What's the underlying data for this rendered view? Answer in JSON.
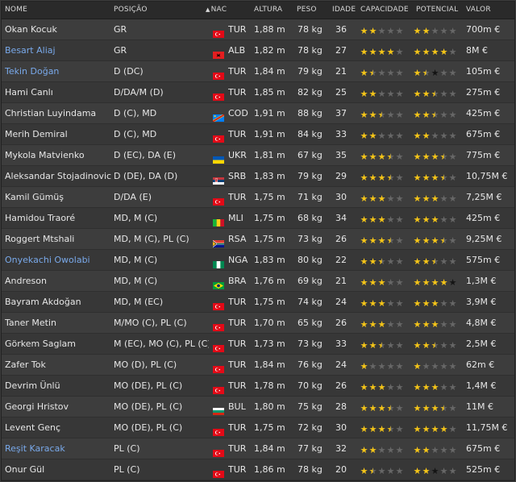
{
  "columns": {
    "name": "NOME",
    "position": "POSIÇÃO",
    "nat": "NAC",
    "height": "ALTURA",
    "weight": "PESO",
    "age": "IDADE",
    "ability": "CAPACIDADE",
    "potential": "POTENCIAL",
    "value": "VALOR"
  },
  "colors": {
    "link": "#79a9ea",
    "star_full": "#f5c518",
    "star_empty": "#676767",
    "star_dark": "#141414"
  },
  "rows": [
    {
      "name": "Okan Kocuk",
      "link": false,
      "position": "GR",
      "flag": "tr",
      "nat": "TUR",
      "height": "1,88 m",
      "weight": "78 kg",
      "age": "36",
      "ability": 2,
      "potential": 2,
      "value": "700m €"
    },
    {
      "name": "Besart Aliaj",
      "link": true,
      "position": "GR",
      "flag": "al",
      "nat": "ALB",
      "height": "1,82 m",
      "weight": "78 kg",
      "age": "27",
      "ability": 4,
      "potential": 4,
      "value": "8M €"
    },
    {
      "name": "Tekin Doğan",
      "link": true,
      "position": "D (DC)",
      "flag": "tr",
      "nat": "TUR",
      "height": "1,84 m",
      "weight": "79 kg",
      "age": "21",
      "ability": 1.5,
      "potential": 1.5,
      "potential_dark": 1,
      "value": "105m €"
    },
    {
      "name": "Hami Canlı",
      "link": false,
      "position": "D/DA/M (D)",
      "flag": "tr",
      "nat": "TUR",
      "height": "1,85 m",
      "weight": "82 kg",
      "age": "25",
      "ability": 2,
      "potential": 2.5,
      "value": "275m €"
    },
    {
      "name": "Christian Luyindama",
      "link": false,
      "position": "D (C), MD",
      "flag": "cd",
      "nat": "COD",
      "height": "1,91 m",
      "weight": "88 kg",
      "age": "37",
      "ability": 2.5,
      "potential": 2.5,
      "value": "425m €"
    },
    {
      "name": "Merih Demiral",
      "link": false,
      "position": "D (C), MD",
      "flag": "tr",
      "nat": "TUR",
      "height": "1,91 m",
      "weight": "84 kg",
      "age": "33",
      "ability": 2,
      "potential": 2,
      "value": "675m €"
    },
    {
      "name": "Mykola Matvienko",
      "link": false,
      "position": "D (EC), DA (E)",
      "flag": "ua",
      "nat": "UKR",
      "height": "1,81 m",
      "weight": "67 kg",
      "age": "35",
      "ability": 3.5,
      "potential": 3.5,
      "value": "775m €"
    },
    {
      "name": "Aleksandar Stojadinovic",
      "link": false,
      "position": "D (DE), DA (D)",
      "flag": "rs",
      "nat": "SRB",
      "height": "1,83 m",
      "weight": "79 kg",
      "age": "29",
      "ability": 3.5,
      "potential": 3.5,
      "value": "10,75M €"
    },
    {
      "name": "Kamil Gümüş",
      "link": false,
      "position": "D/DA (E)",
      "flag": "tr",
      "nat": "TUR",
      "height": "1,75 m",
      "weight": "71 kg",
      "age": "30",
      "ability": 3,
      "potential": 3,
      "value": "7,25M €"
    },
    {
      "name": "Hamidou Traoré",
      "link": false,
      "position": "MD, M (C)",
      "flag": "ml",
      "nat": "MLI",
      "height": "1,75 m",
      "weight": "68 kg",
      "age": "34",
      "ability": 3,
      "potential": 3,
      "value": "425m €"
    },
    {
      "name": "Roggert Mtshali",
      "link": false,
      "position": "MD, M (C), PL (C)",
      "flag": "za",
      "nat": "RSA",
      "height": "1,75 m",
      "weight": "73 kg",
      "age": "26",
      "ability": 3.5,
      "potential": 3.5,
      "value": "9,25M €"
    },
    {
      "name": "Onyekachi Owolabi",
      "link": true,
      "position": "MD, M (C)",
      "flag": "ng",
      "nat": "NGA",
      "height": "1,83 m",
      "weight": "80 kg",
      "age": "22",
      "ability": 2.5,
      "potential": 2.5,
      "value": "575m €"
    },
    {
      "name": "Andreson",
      "link": false,
      "position": "MD, M (C)",
      "flag": "br",
      "nat": "BRA",
      "height": "1,76 m",
      "weight": "69 kg",
      "age": "21",
      "ability": 3,
      "potential": 4,
      "potential_dark": 1,
      "value": "1,3M €"
    },
    {
      "name": "Bayram Akdoğan",
      "link": false,
      "position": "MD, M (EC)",
      "flag": "tr",
      "nat": "TUR",
      "height": "1,75 m",
      "weight": "74 kg",
      "age": "24",
      "ability": 3,
      "potential": 3,
      "value": "3,9M €"
    },
    {
      "name": "Taner Metin",
      "link": false,
      "position": "M/MO (C), PL (C)",
      "flag": "tr",
      "nat": "TUR",
      "height": "1,70 m",
      "weight": "65 kg",
      "age": "26",
      "ability": 3,
      "potential": 3,
      "value": "4,8M €"
    },
    {
      "name": "Görkem Saglam",
      "link": false,
      "position": "M (EC), MO (C), PL (C)",
      "flag": "tr",
      "nat": "TUR",
      "height": "1,73 m",
      "weight": "73 kg",
      "age": "33",
      "ability": 2.5,
      "potential": 2.5,
      "value": "2,5M €"
    },
    {
      "name": "Zafer Tok",
      "link": false,
      "position": "MO (D), PL (C)",
      "flag": "tr",
      "nat": "TUR",
      "height": "1,84 m",
      "weight": "76 kg",
      "age": "24",
      "ability": 1,
      "potential": 1,
      "value": "62m €"
    },
    {
      "name": "Devrim Ünlü",
      "link": false,
      "position": "MO (DE), PL (C)",
      "flag": "tr",
      "nat": "TUR",
      "height": "1,78 m",
      "weight": "70 kg",
      "age": "26",
      "ability": 3,
      "potential": 3,
      "value": "1,4M €"
    },
    {
      "name": "Georgi Hristov",
      "link": false,
      "position": "MO (DE), PL (C)",
      "flag": "bg",
      "nat": "BUL",
      "height": "1,80 m",
      "weight": "75 kg",
      "age": "28",
      "ability": 3.5,
      "potential": 3.5,
      "value": "11M €"
    },
    {
      "name": "Levent Genç",
      "link": false,
      "position": "MO (DE), PL (C)",
      "flag": "tr",
      "nat": "TUR",
      "height": "1,75 m",
      "weight": "72 kg",
      "age": "30",
      "ability": 3.5,
      "potential": 4,
      "value": "11,75M €"
    },
    {
      "name": "Reşit Karacak",
      "link": true,
      "position": "PL (C)",
      "flag": "tr",
      "nat": "TUR",
      "height": "1,84 m",
      "weight": "77 kg",
      "age": "32",
      "ability": 2,
      "potential": 2,
      "value": "675m €"
    },
    {
      "name": "Onur Gül",
      "link": false,
      "position": "PL (C)",
      "flag": "tr",
      "nat": "TUR",
      "height": "1,86 m",
      "weight": "78 kg",
      "age": "20",
      "ability": 1.5,
      "potential": 2,
      "potential_dark": 1,
      "value": "525m €"
    }
  ]
}
